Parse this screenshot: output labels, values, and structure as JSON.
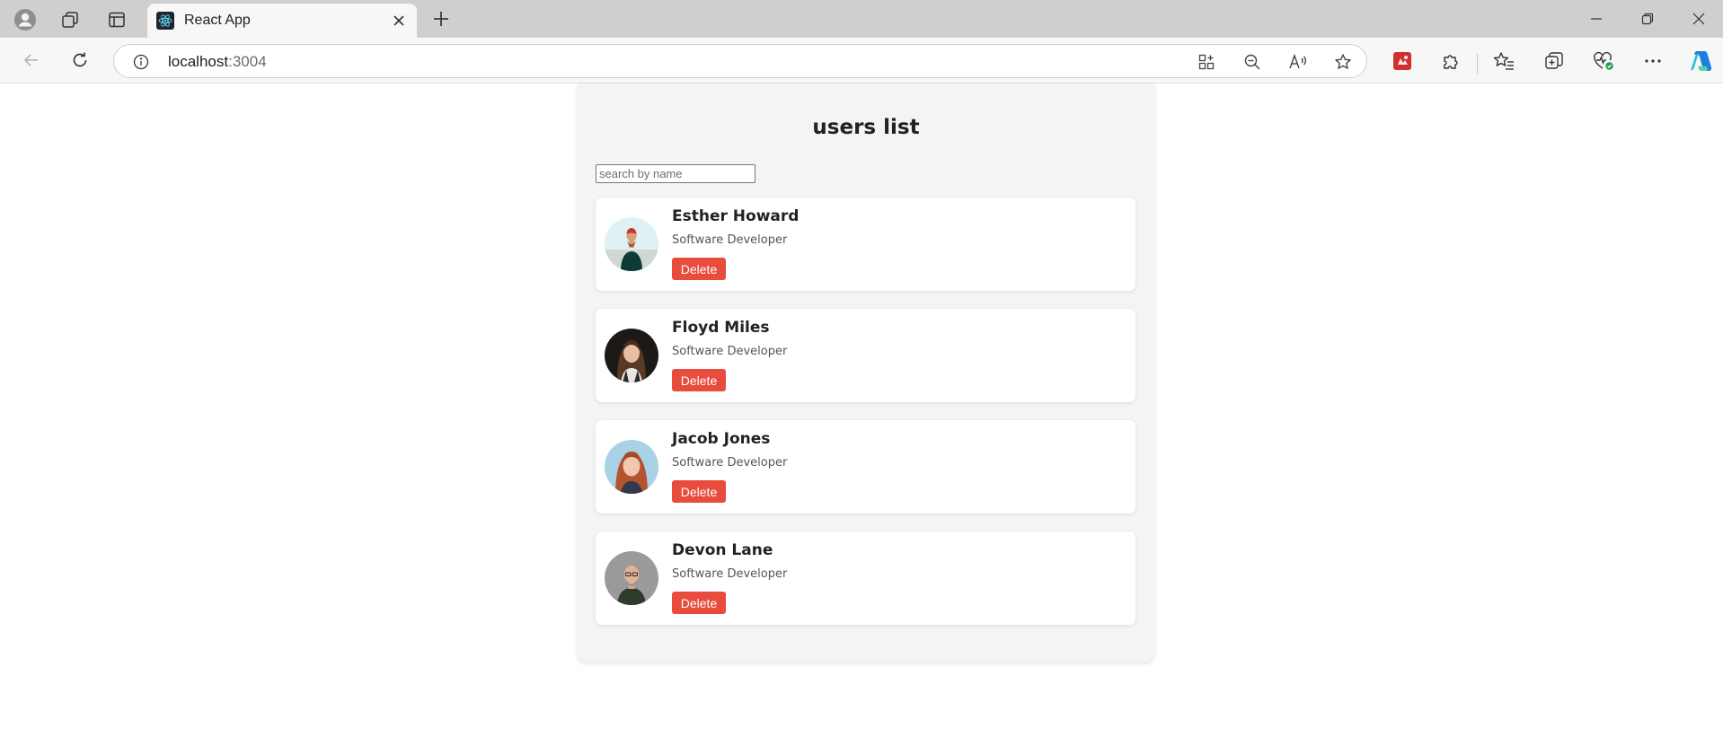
{
  "browser": {
    "tab_title": "React App",
    "address_host": "localhost",
    "address_port": ":3004",
    "icons": {
      "profile": "profile-icon",
      "workspaces": "workspaces-icon",
      "tab_actions": "vertical-tabs-icon",
      "favicon": "react-logo-icon",
      "tab_close": "close-icon",
      "new_tab": "plus-icon",
      "back": "back-arrow-icon",
      "refresh": "refresh-icon",
      "site_info": "info-icon",
      "app_available": "app-available-icon",
      "zoom_out": "zoom-out-icon",
      "read_aloud": "read-aloud-icon",
      "favorite": "star-icon",
      "extension_red": "extension-red-icon",
      "extensions": "puzzle-icon",
      "favorites": "favorites-icon",
      "collections": "collections-icon",
      "browser_essentials": "heart-pulse-icon",
      "more": "more-icon",
      "copilot": "copilot-icon",
      "minimize": "minimize-icon",
      "restore": "restore-icon",
      "close_window": "close-window-icon"
    }
  },
  "page": {
    "title": "users list",
    "search": {
      "value": "",
      "placeholder": "search by name"
    },
    "users": [
      {
        "name": "Esther Howard",
        "role": "Software Developer",
        "delete_label": "Delete"
      },
      {
        "name": "Floyd Miles",
        "role": "Software Developer",
        "delete_label": "Delete"
      },
      {
        "name": "Jacob Jones",
        "role": "Software Developer",
        "delete_label": "Delete"
      },
      {
        "name": "Devon Lane",
        "role": "Software Developer",
        "delete_label": "Delete"
      }
    ]
  },
  "colors": {
    "delete_button": "#e74c3c",
    "panel_background": "#f4f4f4",
    "card_background": "#ffffff"
  }
}
